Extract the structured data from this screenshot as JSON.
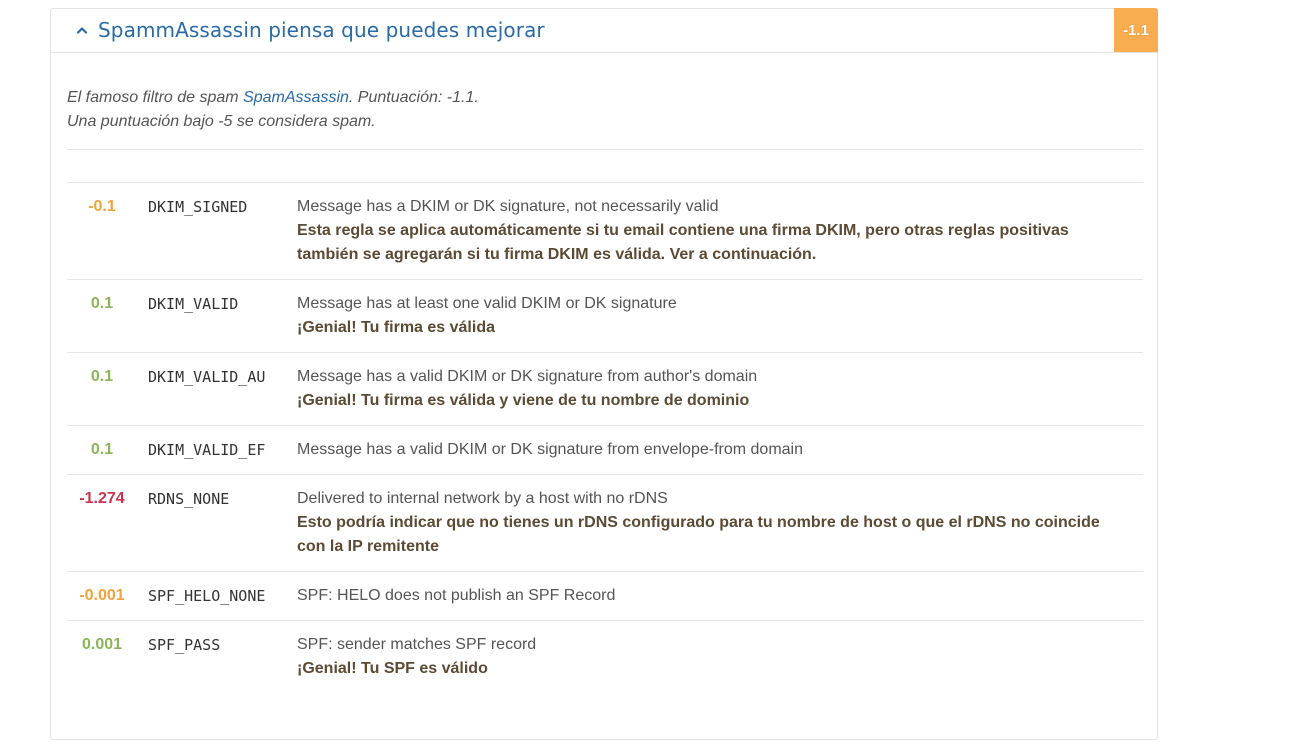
{
  "header": {
    "title": "SpammAssassin piensa que puedes mejorar",
    "score": "-1.1",
    "badge_color": "#f9ad50",
    "title_color": "#2a6aa5",
    "chevron_icon": "chevron-up-icon"
  },
  "intro": {
    "prefix": "El famoso filtro de spam ",
    "link_text": "SpamAssassin",
    "score_text": ". Puntuación: -1.1.",
    "line2": "Una puntuación bajo -5 se considera spam."
  },
  "colors": {
    "negative": "#c9344e",
    "warning": "#f0a33a",
    "positive": "#8cb55b"
  },
  "rules": [
    {
      "score": "-0.1",
      "kind": "warn",
      "name": "DKIM_SIGNED",
      "description": "Message has a DKIM or DK signature, not necessarily valid",
      "tip": "Esta regla se aplica automáticamente si tu email contiene una firma DKIM, pero otras reglas positivas también se agregarán si tu firma DKIM es válida. Ver a continuación."
    },
    {
      "score": "0.1",
      "kind": "pos",
      "name": "DKIM_VALID",
      "description": "Message has at least one valid DKIM or DK signature",
      "tip": "¡Genial! Tu firma es válida"
    },
    {
      "score": "0.1",
      "kind": "pos",
      "name": "DKIM_VALID_AU",
      "description": "Message has a valid DKIM or DK signature from author's domain",
      "tip": "¡Genial! Tu firma es válida y viene de tu nombre de dominio"
    },
    {
      "score": "0.1",
      "kind": "pos",
      "name": "DKIM_VALID_EF",
      "description": "Message has a valid DKIM or DK signature from envelope-from domain",
      "tip": ""
    },
    {
      "score": "-1.274",
      "kind": "neg",
      "name": "RDNS_NONE",
      "description": "Delivered to internal network by a host with no rDNS",
      "tip": "Esto podría indicar que no tienes un rDNS configurado para tu nombre de host o que el rDNS no coincide con la IP remitente"
    },
    {
      "score": "-0.001",
      "kind": "warn",
      "name": "SPF_HELO_NONE",
      "description": "SPF: HELO does not publish an SPF Record",
      "tip": ""
    },
    {
      "score": "0.001",
      "kind": "pos",
      "name": "SPF_PASS",
      "description": "SPF: sender matches SPF record",
      "tip": "¡Genial! Tu SPF es válido"
    }
  ]
}
